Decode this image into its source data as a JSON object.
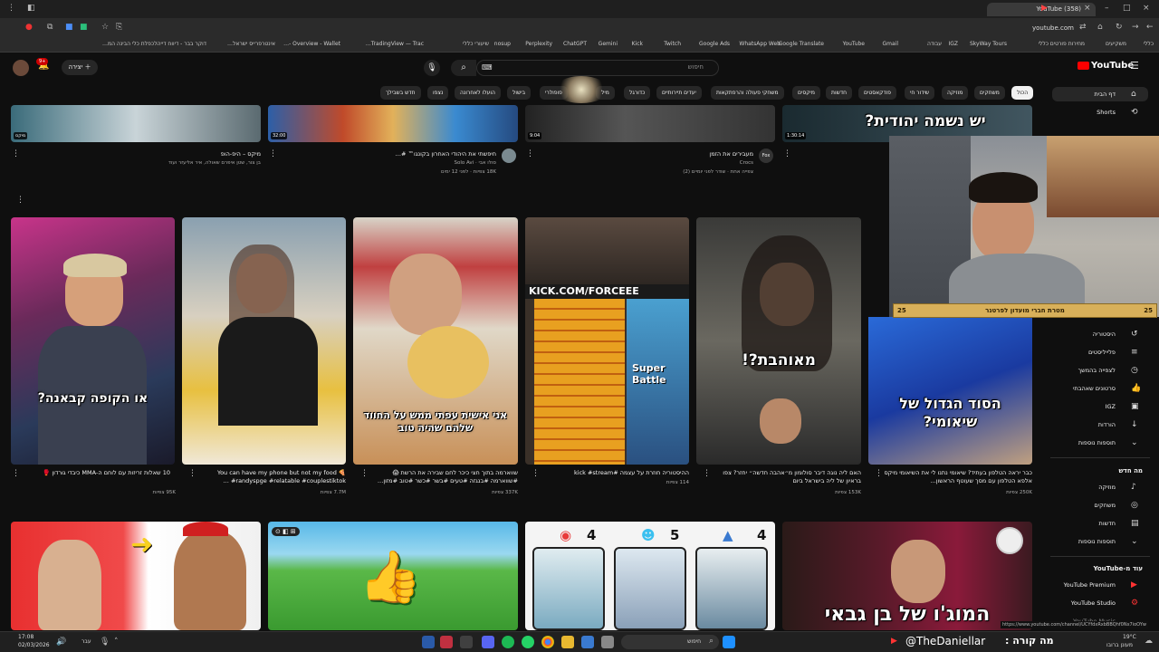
{
  "browser": {
    "tab_title": "(358) YouTube",
    "url": "youtube.com",
    "bookmarks": [
      "כללי",
      "משקיעים",
      "מחירות פורטים כללי",
      "SkyWay Tours",
      "IGZ",
      "עבודה",
      "Gmail",
      "YouTube",
      "Google Translate",
      "WhatsApp Web",
      "Google Ads",
      "Twitch",
      "Kick",
      "Gemini",
      "ChatGPT",
      "Perplexity",
      "nosup",
      "שיעורי כללי",
      "TradingView — Trac…",
      "Overview - Wallet -…",
      "אינטרפרייס ישראל…",
      "דוקר בבר - דיווח דייהל",
      "כפלת כלי הבינה המ…"
    ]
  },
  "header": {
    "logo_text": "YouTube",
    "search_placeholder": "חיפוש",
    "create_label": "יצירה",
    "notif_count": "9+"
  },
  "chips": [
    "הכול",
    "משחקים",
    "מוזיקה",
    "שידור חי",
    "פודקאסטים",
    "חדשות",
    "מיקסים",
    "משחקי פעולה והרפתקאות",
    "יעדים תיירותיים",
    "כדורגל",
    "מיל",
    "פופולרי",
    "בישול",
    "הועלו לאחרונה",
    "נצפו",
    "חדש בשבילך"
  ],
  "sidebar": {
    "home": "דף הבית",
    "shorts": "Shorts",
    "history": "היסטוריה",
    "playlists": "פלייליסטים",
    "watch_later": "לצפייה בהמשך",
    "liked": "סרטונים שאהבתי",
    "igz": "IGZ",
    "downloads": "הורדות",
    "show_more": "תוספות נוספות",
    "section_new": "מה חדש",
    "music": "מוזיקה",
    "gaming": "משחקים",
    "news": "חדשות",
    "show_more2": "תוספות נוספות",
    "section_more": "עוד מ-YouTube",
    "premium": "YouTube Premium",
    "studio": "YouTube Studio",
    "music_app": "YouTube Music"
  },
  "top_row": [
    {
      "title": "מיקס – היפ-הופ",
      "meta": "בן צור, שטן איפרם שאולה, איר אליעזר ועוד",
      "badge": "מיקס"
    },
    {
      "title": "חיפשתי את היהודי האחרון בקונגו™ #…",
      "meta": "סולו אבי · Solo Avi",
      "meta2": "18K צפיות · לפני 12 ימים",
      "duration": "32:00"
    },
    {
      "title": "מעבירים את הזמן",
      "meta": "Crocs",
      "meta2": "צפייה אחת · שודר לפני יומיים (2)",
      "duration": "9:04"
    },
    {
      "title": "",
      "meta": "",
      "duration": "1:30:14",
      "caption": "יש נשמה יהודית?"
    }
  ],
  "shorts": [
    {
      "title": "10 שאלות זריזות עם לוחם ה-MMA כיבדי גורדון 🥊",
      "meta": "95K צפיות",
      "caption": "או הקופה קבאנה?"
    },
    {
      "title": "You can have my phone but not my food 🍕 #randyspge #relatable #couplestiktok …",
      "meta": "7.7M צפיות",
      "caption": ""
    },
    {
      "title": "שווארמה בתוך חצי כיכר לחם שבירה את הרשת 😱 #שווארמה #בנגזה #טעים #בשר #כשר #טוב #מזון…",
      "meta": "337K צפיות",
      "caption": "אני אישית עפתי ממש על החווד שלהם שהיה טוב"
    },
    {
      "title": "ההיסטוריה חוזרת על עצמה #kick #stream",
      "meta": "114 צפיות",
      "caption": "",
      "kick": "KICK.COM/FORCEEE",
      "game": "Super Battle"
    },
    {
      "title": "האם ליה נוגה דיבר סולומון מ״אהבה חדשה״ יחזר? צפו בראיון של ליה בישראל ביום",
      "meta": "153K צפיות",
      "caption": "מאוהבת?!"
    },
    {
      "title": "כבר יראה הטלפון בעתיד? שיאומי נתנו לי את השיאומי מיקס אלפא הטלפון עם מסך שעוטף הראשון…",
      "meta": "250K צפיות",
      "caption": "הסוד הגדול של שיאומי?"
    }
  ],
  "bottom_row": [
    {
      "label": "fitness-thumb"
    },
    {
      "label": "roblox-thumb"
    },
    {
      "nums": [
        "4",
        "5",
        "4"
      ]
    },
    {
      "caption": "המוג'ו של בן גבאי"
    }
  ],
  "overlay": {
    "banner_left": "25",
    "banner_text": "מטרת חברי מועדון לפרטנר",
    "banner_right": "25",
    "handle": "@TheDaniellar",
    "now": "מה קורה :",
    "status_url": "https://www.youtube.com/channel/UCYfdxRxbBBQhf0Nx7ioOYw"
  },
  "taskbar": {
    "time": "17:08",
    "date": "02/03/2026",
    "lang": "עבר",
    "search": "חיפוש",
    "weather": "19°C",
    "weather_desc": "מעונן ברובו"
  }
}
